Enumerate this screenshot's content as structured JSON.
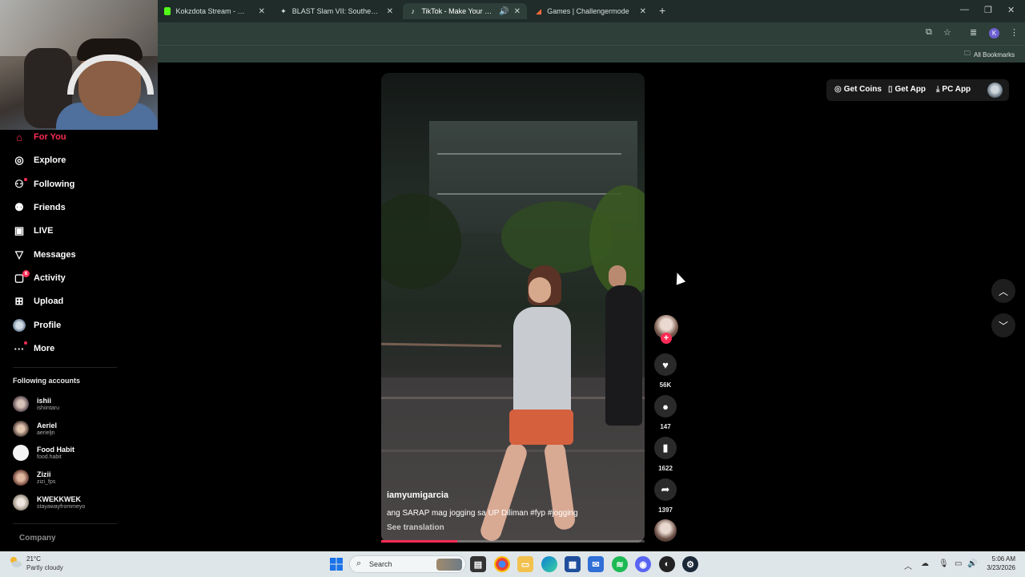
{
  "browser": {
    "tabs": [
      {
        "title": "Kokzdota Stream - Watch Live",
        "icon": "kick-icon",
        "active": false
      },
      {
        "title": "BLAST Slam VII: Southeast Asia",
        "icon": "blast-icon",
        "active": false
      },
      {
        "title": "TikTok - Make Your Day",
        "icon": "tiktok-icon",
        "active": true,
        "audio": true
      },
      {
        "title": "Games | Challengermode",
        "icon": "challengermode-icon",
        "active": false
      }
    ],
    "new_tab_label": "+",
    "profile_initial": "K",
    "bookmarks_label": "All Bookmarks"
  },
  "sidebar": {
    "items": [
      {
        "label": "For You",
        "icon": "home-icon"
      },
      {
        "label": "Explore",
        "icon": "compass-icon"
      },
      {
        "label": "Following",
        "icon": "following-icon"
      },
      {
        "label": "Friends",
        "icon": "friends-icon"
      },
      {
        "label": "LIVE",
        "icon": "live-icon"
      },
      {
        "label": "Messages",
        "icon": "messages-icon"
      },
      {
        "label": "Activity",
        "icon": "activity-icon",
        "badge": "6"
      },
      {
        "label": "Upload",
        "icon": "upload-icon"
      },
      {
        "label": "Profile",
        "icon": "profile-icon"
      },
      {
        "label": "More",
        "icon": "more-icon"
      }
    ],
    "following_title": "Following accounts",
    "accounts": [
      {
        "name": "ishii",
        "handle": "ishiintaru"
      },
      {
        "name": "Aeriel",
        "handle": "aerieljn"
      },
      {
        "name": "Food Habit",
        "handle": "food.habit"
      },
      {
        "name": "Zizii",
        "handle": "zizi_fps"
      },
      {
        "name": "KWEKKWEK",
        "handle": "stayawayfrommeyo"
      }
    ],
    "company_label": "Company"
  },
  "topbar": {
    "get_coins": "Get Coins",
    "get_app": "Get App",
    "pc_app": "PC App"
  },
  "video": {
    "username": "iamyumigarcia",
    "caption": "ang SARAP mag jogging sa UP Diliman #fyp #jogging",
    "see_translation": "See translation",
    "progress_percent": 29
  },
  "actions": {
    "likes": "56K",
    "comments": "147",
    "saves": "1622",
    "shares": "1397"
  },
  "taskbar": {
    "temperature": "21°C",
    "weather": "Partly cloudy",
    "search_placeholder": "Search",
    "time": "5:06 AM",
    "date": "3/23/2026"
  },
  "colors": {
    "accent": "#fe2c55",
    "tab_bar": "#1f2c29",
    "toolbar": "#2e3f3a"
  }
}
